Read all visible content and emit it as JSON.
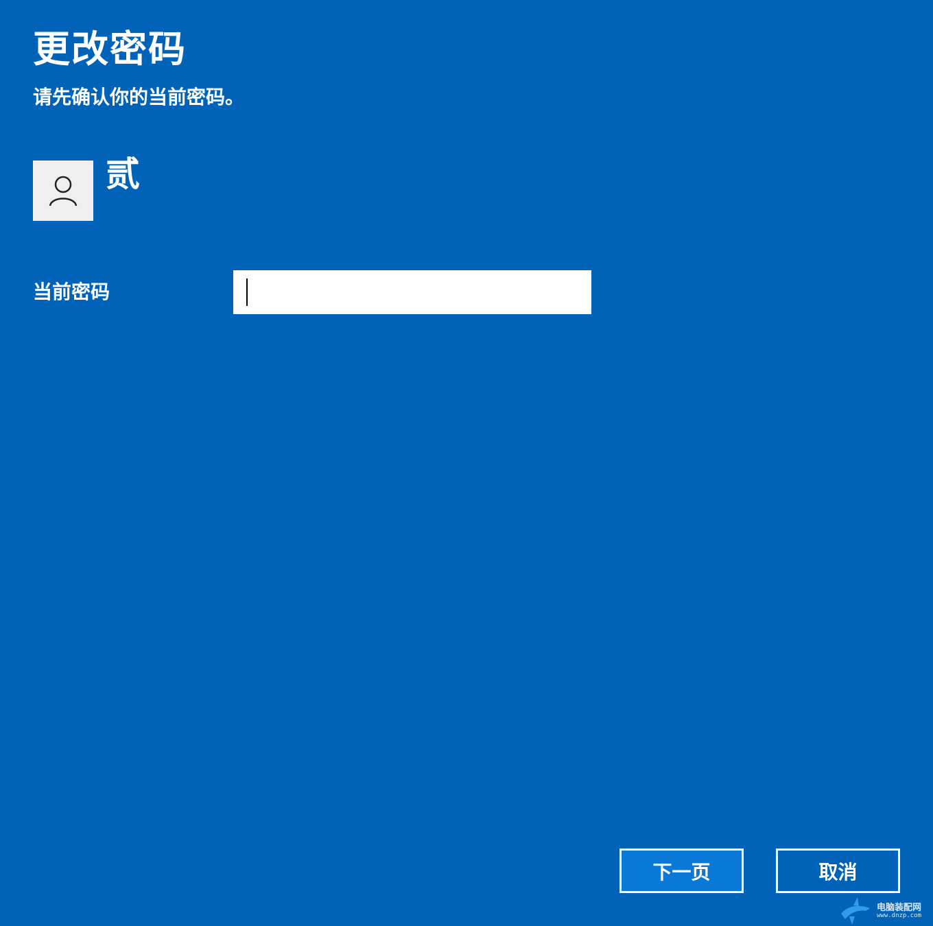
{
  "window": {
    "title": "更改密码",
    "subtitle": "请先确认你的当前密码。"
  },
  "user": {
    "name": "贰",
    "avatar_icon": "person-icon"
  },
  "form": {
    "current_password_label": "当前密码",
    "current_password_value": ""
  },
  "buttons": {
    "next_label": "下一页",
    "cancel_label": "取消"
  },
  "watermark": {
    "title": "电脑装配网",
    "url": "www.dnzp.com"
  },
  "colors": {
    "background": "#0063B8",
    "primary_button": "#0A78D7",
    "text": "#FFFFFF",
    "avatar_bg": "#EFEFEF"
  }
}
